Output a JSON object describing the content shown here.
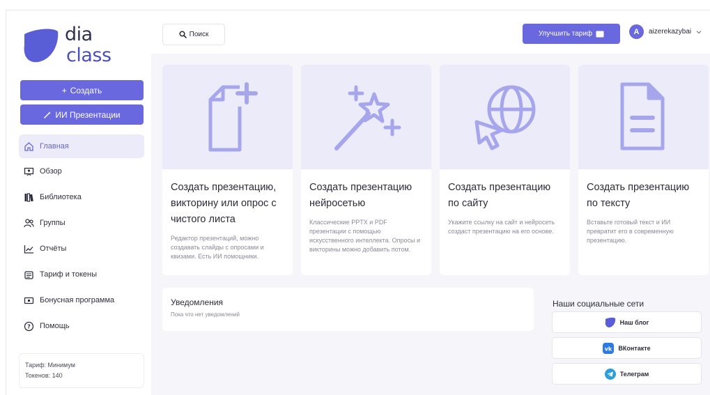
{
  "logo": {
    "line1": "dia",
    "line2": "class"
  },
  "sidebar": {
    "create_label": "Создать",
    "ai_label": "ИИ Презентации",
    "items": [
      {
        "label": "Главная",
        "icon": "home-icon"
      },
      {
        "label": "Обзор",
        "icon": "presentation-icon"
      },
      {
        "label": "Библиотека",
        "icon": "library-icon"
      },
      {
        "label": "Группы",
        "icon": "users-icon"
      },
      {
        "label": "Отчёты",
        "icon": "chart-icon"
      },
      {
        "label": "Тариф и токены",
        "icon": "coins-icon"
      },
      {
        "label": "Бонусная программа",
        "icon": "bonus-icon"
      },
      {
        "label": "Помощь",
        "icon": "help-icon"
      }
    ],
    "plan": {
      "tariff": "Тариф: Минимум",
      "tokens": "Токенов: 140"
    }
  },
  "header": {
    "search_label": "Поиск",
    "upgrade_label": "Улучшить тариф",
    "avatar_letter": "A",
    "username": "aizerekazybai"
  },
  "cards": [
    {
      "title": "Создать презентацию, викторину или опрос с чистого листа",
      "desc": "Редактор презентаций, можно создавать слайды с опросами и квизами. Есть ИИ помощники."
    },
    {
      "title": "Создать презентацию нейросетью",
      "desc": "Классические PPTX и PDF презентации с помощью искусственного интеллекта. Опросы и викторины можно добавить потом."
    },
    {
      "title": "Создать презентацию по сайту",
      "desc": "Укажите ссылку на сайт и нейросеть создаст презентацию на его основе."
    },
    {
      "title": "Создать презентацию по тексту",
      "desc": "Вставьте готовый текст и ИИ превратит его в современную презентацию."
    }
  ],
  "notifications": {
    "title": "Уведомления",
    "empty": "Пока что нет уведомлений"
  },
  "social": {
    "title": "Наши социальные сети",
    "links": [
      "Наш блог",
      "ВКонтакте",
      "Телеграм"
    ]
  },
  "colors": {
    "accent": "#6a68df",
    "accent_light": "#ebebfa",
    "icon": "#a7a6ec"
  }
}
